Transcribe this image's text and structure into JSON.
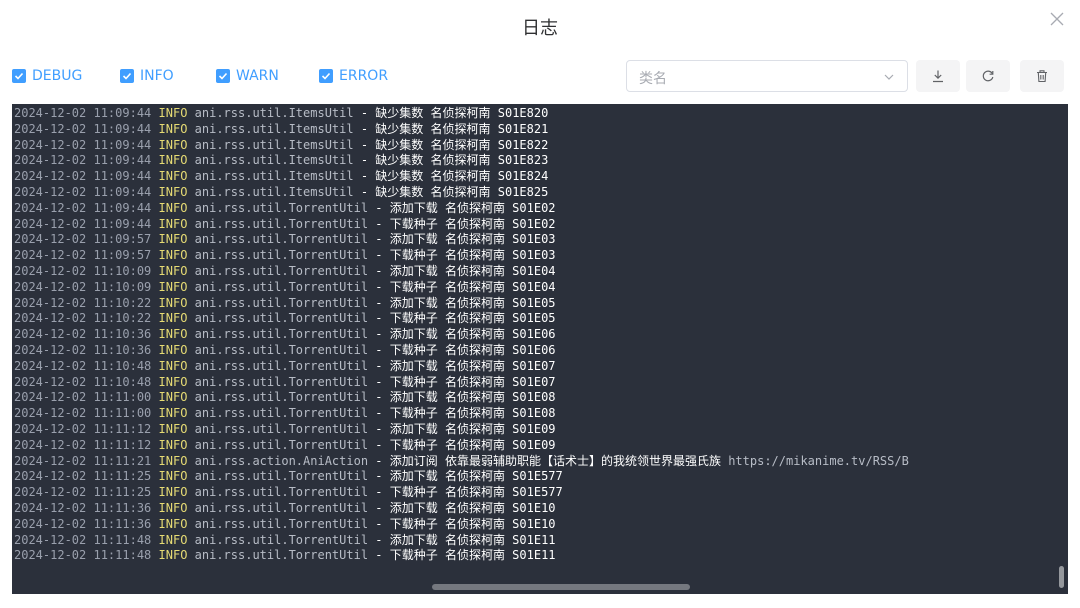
{
  "dialog": {
    "title": "日志",
    "close_icon": "close-icon"
  },
  "filters": [
    {
      "label": "DEBUG",
      "checked": true
    },
    {
      "label": "INFO",
      "checked": true
    },
    {
      "label": "WARN",
      "checked": true
    },
    {
      "label": "ERROR",
      "checked": true
    }
  ],
  "class_select": {
    "placeholder": "类名",
    "value": ""
  },
  "actions": [
    {
      "icon": "download-icon"
    },
    {
      "icon": "refresh-icon"
    },
    {
      "icon": "trash-icon"
    }
  ],
  "colors": {
    "accent": "#409eff",
    "log_bg": "#2b303b",
    "level": "#e6db74"
  },
  "logs": [
    {
      "time": "2024-12-02 11:09:44",
      "level": "INFO",
      "logger": "ani.rss.util.ItemsUtil",
      "message": "缺少集数 名侦探柯南 S01E820"
    },
    {
      "time": "2024-12-02 11:09:44",
      "level": "INFO",
      "logger": "ani.rss.util.ItemsUtil",
      "message": "缺少集数 名侦探柯南 S01E821"
    },
    {
      "time": "2024-12-02 11:09:44",
      "level": "INFO",
      "logger": "ani.rss.util.ItemsUtil",
      "message": "缺少集数 名侦探柯南 S01E822"
    },
    {
      "time": "2024-12-02 11:09:44",
      "level": "INFO",
      "logger": "ani.rss.util.ItemsUtil",
      "message": "缺少集数 名侦探柯南 S01E823"
    },
    {
      "time": "2024-12-02 11:09:44",
      "level": "INFO",
      "logger": "ani.rss.util.ItemsUtil",
      "message": "缺少集数 名侦探柯南 S01E824"
    },
    {
      "time": "2024-12-02 11:09:44",
      "level": "INFO",
      "logger": "ani.rss.util.ItemsUtil",
      "message": "缺少集数 名侦探柯南 S01E825"
    },
    {
      "time": "2024-12-02 11:09:44",
      "level": "INFO",
      "logger": "ani.rss.util.TorrentUtil",
      "message": "添加下载 名侦探柯南 S01E02"
    },
    {
      "time": "2024-12-02 11:09:44",
      "level": "INFO",
      "logger": "ani.rss.util.TorrentUtil",
      "message": "下载种子 名侦探柯南 S01E02"
    },
    {
      "time": "2024-12-02 11:09:57",
      "level": "INFO",
      "logger": "ani.rss.util.TorrentUtil",
      "message": "添加下载 名侦探柯南 S01E03"
    },
    {
      "time": "2024-12-02 11:09:57",
      "level": "INFO",
      "logger": "ani.rss.util.TorrentUtil",
      "message": "下载种子 名侦探柯南 S01E03"
    },
    {
      "time": "2024-12-02 11:10:09",
      "level": "INFO",
      "logger": "ani.rss.util.TorrentUtil",
      "message": "添加下载 名侦探柯南 S01E04"
    },
    {
      "time": "2024-12-02 11:10:09",
      "level": "INFO",
      "logger": "ani.rss.util.TorrentUtil",
      "message": "下载种子 名侦探柯南 S01E04"
    },
    {
      "time": "2024-12-02 11:10:22",
      "level": "INFO",
      "logger": "ani.rss.util.TorrentUtil",
      "message": "添加下载 名侦探柯南 S01E05"
    },
    {
      "time": "2024-12-02 11:10:22",
      "level": "INFO",
      "logger": "ani.rss.util.TorrentUtil",
      "message": "下载种子 名侦探柯南 S01E05"
    },
    {
      "time": "2024-12-02 11:10:36",
      "level": "INFO",
      "logger": "ani.rss.util.TorrentUtil",
      "message": "添加下载 名侦探柯南 S01E06"
    },
    {
      "time": "2024-12-02 11:10:36",
      "level": "INFO",
      "logger": "ani.rss.util.TorrentUtil",
      "message": "下载种子 名侦探柯南 S01E06"
    },
    {
      "time": "2024-12-02 11:10:48",
      "level": "INFO",
      "logger": "ani.rss.util.TorrentUtil",
      "message": "添加下载 名侦探柯南 S01E07"
    },
    {
      "time": "2024-12-02 11:10:48",
      "level": "INFO",
      "logger": "ani.rss.util.TorrentUtil",
      "message": "下载种子 名侦探柯南 S01E07"
    },
    {
      "time": "2024-12-02 11:11:00",
      "level": "INFO",
      "logger": "ani.rss.util.TorrentUtil",
      "message": "添加下载 名侦探柯南 S01E08"
    },
    {
      "time": "2024-12-02 11:11:00",
      "level": "INFO",
      "logger": "ani.rss.util.TorrentUtil",
      "message": "下载种子 名侦探柯南 S01E08"
    },
    {
      "time": "2024-12-02 11:11:12",
      "level": "INFO",
      "logger": "ani.rss.util.TorrentUtil",
      "message": "添加下载 名侦探柯南 S01E09"
    },
    {
      "time": "2024-12-02 11:11:12",
      "level": "INFO",
      "logger": "ani.rss.util.TorrentUtil",
      "message": "下载种子 名侦探柯南 S01E09"
    },
    {
      "time": "2024-12-02 11:11:21",
      "level": "INFO",
      "logger": "ani.rss.action.AniAction",
      "message": "添加订阅 依靠最弱辅助职能【话术士】的我统领世界最强氏族",
      "url": "https://mikanime.tv/RSS/B"
    },
    {
      "time": "2024-12-02 11:11:25",
      "level": "INFO",
      "logger": "ani.rss.util.TorrentUtil",
      "message": "添加下载 名侦探柯南 S01E577"
    },
    {
      "time": "2024-12-02 11:11:25",
      "level": "INFO",
      "logger": "ani.rss.util.TorrentUtil",
      "message": "下载种子 名侦探柯南 S01E577"
    },
    {
      "time": "2024-12-02 11:11:36",
      "level": "INFO",
      "logger": "ani.rss.util.TorrentUtil",
      "message": "添加下载 名侦探柯南 S01E10"
    },
    {
      "time": "2024-12-02 11:11:36",
      "level": "INFO",
      "logger": "ani.rss.util.TorrentUtil",
      "message": "下载种子 名侦探柯南 S01E10"
    },
    {
      "time": "2024-12-02 11:11:48",
      "level": "INFO",
      "logger": "ani.rss.util.TorrentUtil",
      "message": "添加下载 名侦探柯南 S01E11"
    },
    {
      "time": "2024-12-02 11:11:48",
      "level": "INFO",
      "logger": "ani.rss.util.TorrentUtil",
      "message": "下载种子 名侦探柯南 S01E11"
    }
  ]
}
